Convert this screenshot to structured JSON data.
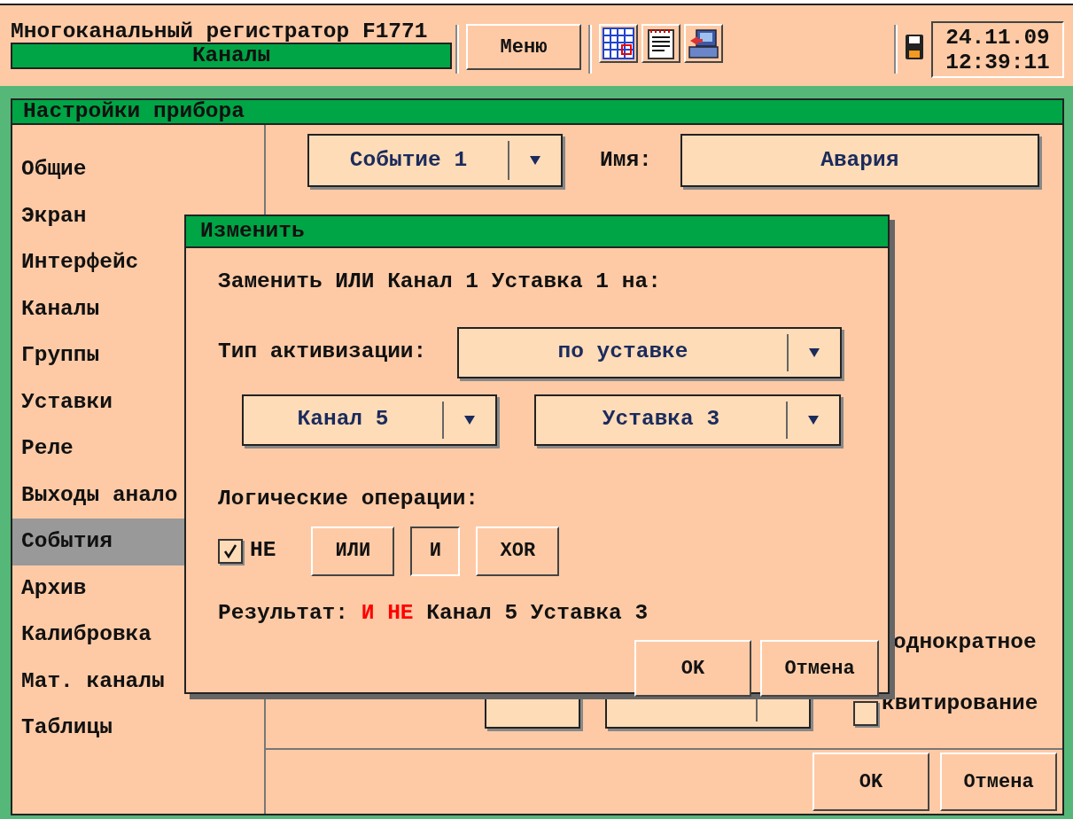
{
  "header": {
    "title": "Многоканальный регистратор F1771",
    "mode": "Каналы",
    "menu_button": "Меню",
    "date": "24.11.09",
    "time": "12:39:11"
  },
  "settings": {
    "title": "Настройки прибора",
    "sidebar": {
      "items": [
        {
          "label": "Общие",
          "selected": false
        },
        {
          "label": "Экран",
          "selected": false
        },
        {
          "label": "Интерфейс",
          "selected": false
        },
        {
          "label": "Каналы",
          "selected": false
        },
        {
          "label": "Группы",
          "selected": false
        },
        {
          "label": "Уставки",
          "selected": false
        },
        {
          "label": "Реле",
          "selected": false
        },
        {
          "label": "Выходы анало",
          "selected": false
        },
        {
          "label": "События",
          "selected": true
        },
        {
          "label": "Архив",
          "selected": false
        },
        {
          "label": "Калибровка",
          "selected": false
        },
        {
          "label": "Мат. каналы",
          "selected": false
        },
        {
          "label": "Таблицы",
          "selected": false
        }
      ]
    },
    "event_select": "Событие 1",
    "name_label": "Имя:",
    "name_value": "Авария",
    "once_label": "однократное",
    "ack": {
      "label": "квитирование",
      "checked": false
    },
    "buttons": [
      "OK",
      "Отмена"
    ]
  },
  "dialog": {
    "title": "Изменить",
    "prompt": "Заменить ИЛИ Канал 1 Уставка 1 на:",
    "activation_label": "Тип активизации:",
    "activation_value": "по уставке",
    "channel": "Канал 5",
    "setpoint": "Уставка 3",
    "logic_label": "Логические операции:",
    "not_option": {
      "label": "НЕ",
      "checked": true
    },
    "operations": [
      {
        "label": "ИЛИ",
        "selected": false
      },
      {
        "label": "И",
        "selected": true
      },
      {
        "label": "XOR",
        "selected": false
      }
    ],
    "result_label": "Результат:",
    "result_ops": "И НЕ",
    "result_target": "Канал 5 Уставка 3",
    "buttons": [
      "OK",
      "Отмена"
    ]
  }
}
